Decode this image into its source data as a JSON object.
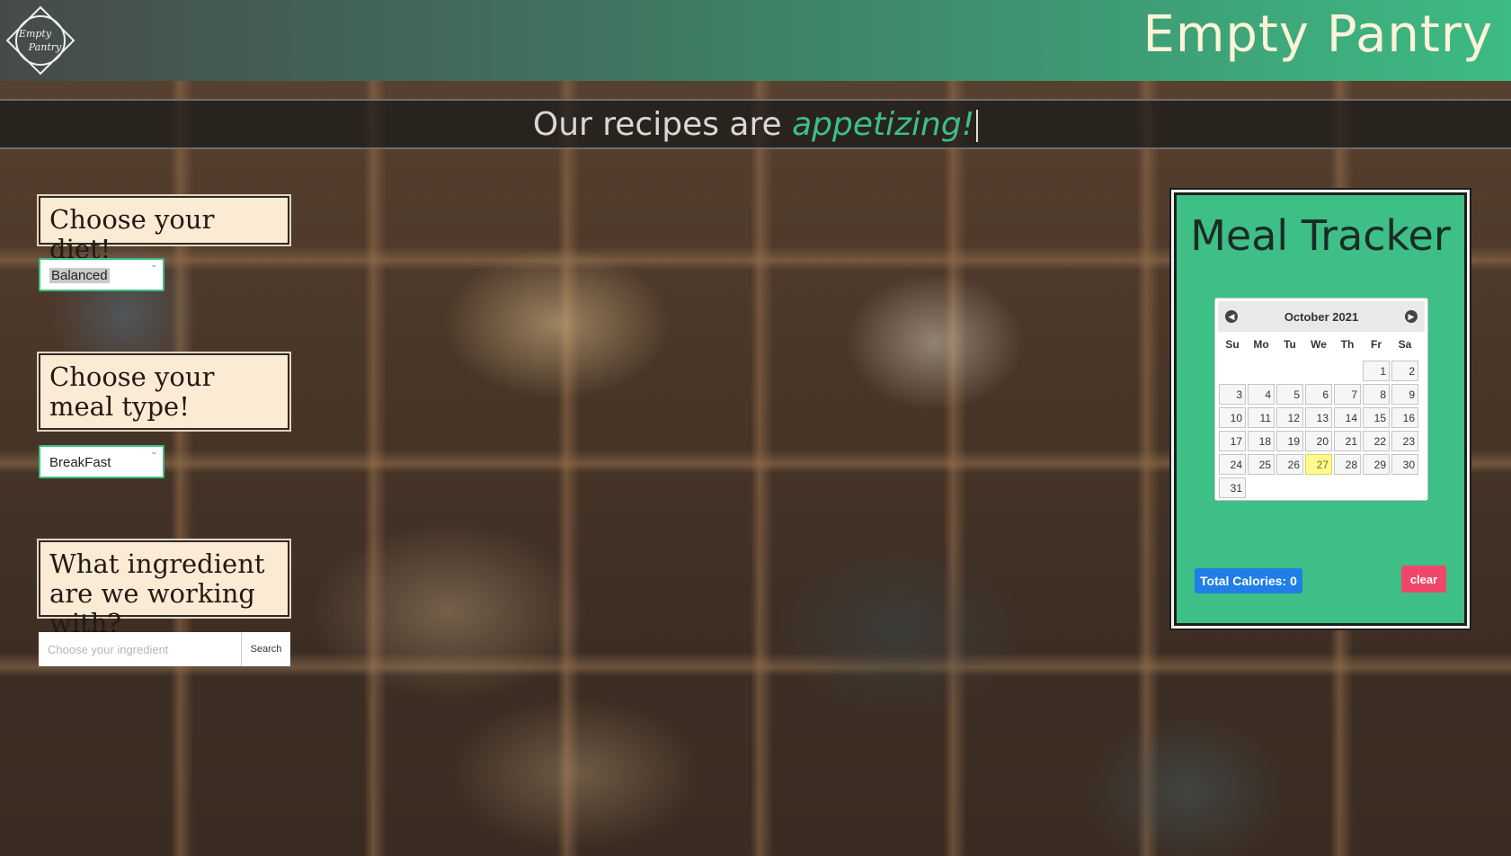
{
  "header": {
    "logo_text_line1": "Empty",
    "logo_text_line2": "Pantry",
    "brand": "Empty Pantry"
  },
  "tagline": {
    "prefix": "Our recipes are ",
    "accent": "appetizing!"
  },
  "diet": {
    "heading": "Choose your diet!",
    "selected": "Balanced"
  },
  "meal_type": {
    "heading": "Choose your meal type!",
    "selected": "BreakFast"
  },
  "ingredient": {
    "heading": "What ingredient are we working with?",
    "placeholder": "Choose your ingredient",
    "button": "Search"
  },
  "tracker": {
    "title": "Meal Tracker",
    "calendar": {
      "month_label": "October 2021",
      "weekdays": [
        "Su",
        "Mo",
        "Tu",
        "We",
        "Th",
        "Fr",
        "Sa"
      ],
      "leading_blanks": 5,
      "days_in_month": 31,
      "today": 27
    },
    "calories_label": "Total Calories: 0",
    "clear_label": "clear"
  },
  "colors": {
    "accent_green": "#3dbf86",
    "calories_blue": "#1f7ee8",
    "clear_pink": "#f0466a",
    "prompt_bg": "#fbead4",
    "today_highlight": "#fffa90"
  }
}
